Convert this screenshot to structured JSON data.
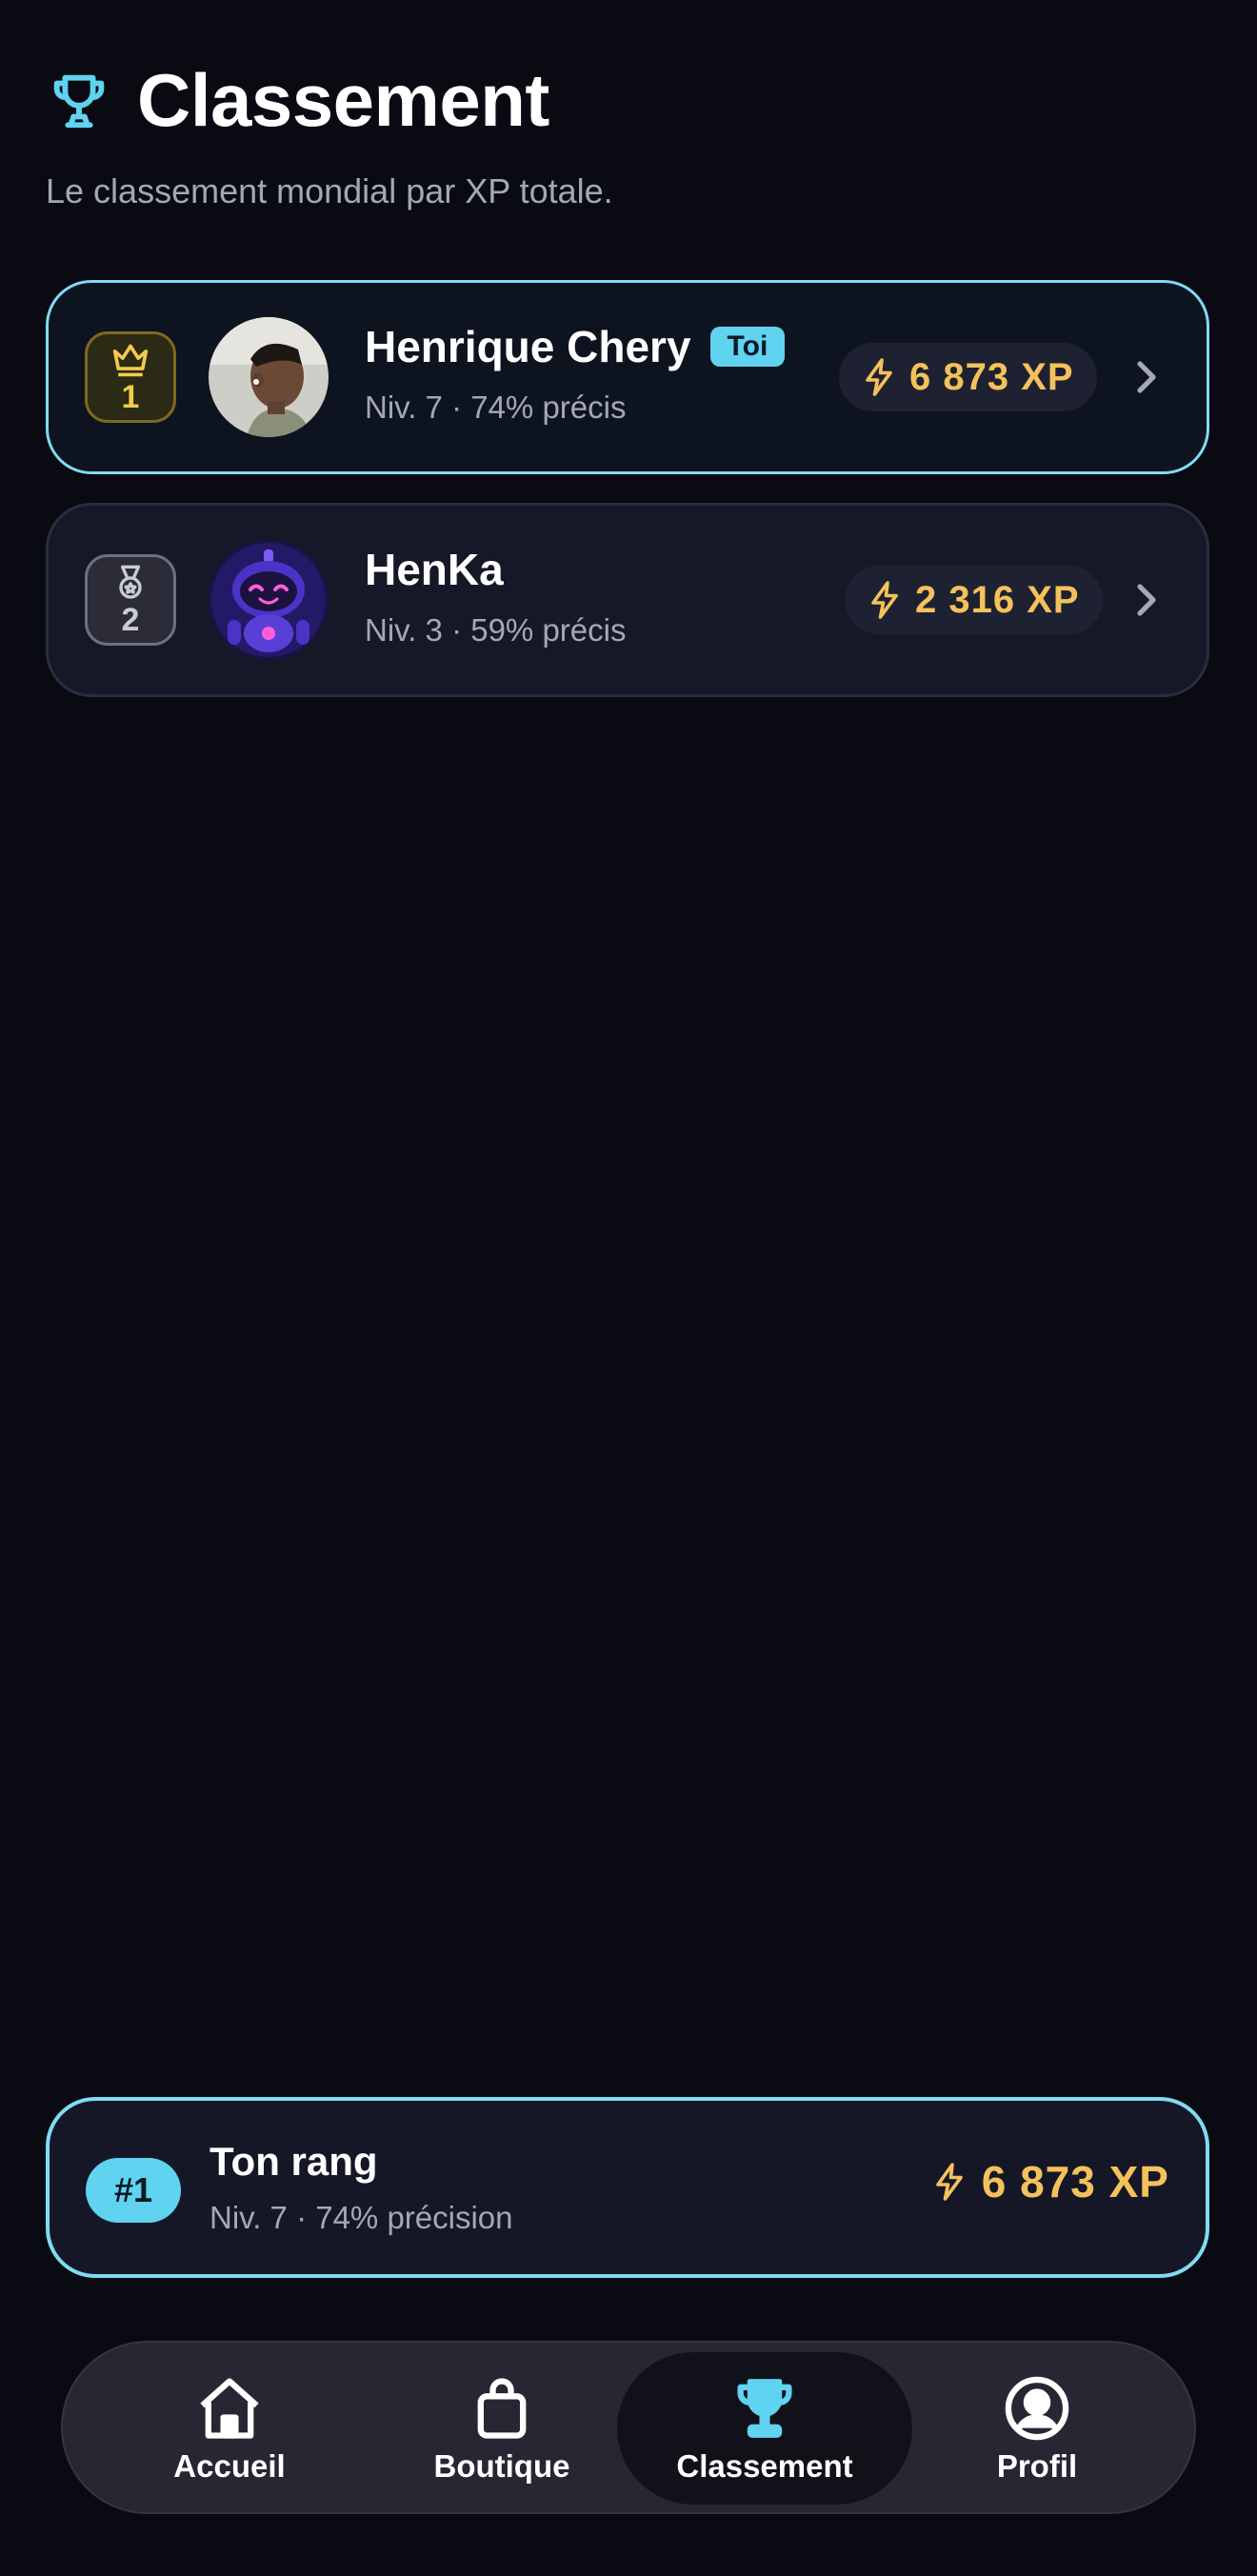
{
  "header": {
    "title": "Classement",
    "subtitle": "Le classement mondial par XP totale."
  },
  "leaderboard": [
    {
      "rank": "1",
      "name": "Henrique Chery",
      "tag": "Toi",
      "stats": "Niv. 7 · 74% précis",
      "xp": "6 873 XP"
    },
    {
      "rank": "2",
      "name": "HenKa",
      "stats": "Niv. 3 · 59% précis",
      "xp": "2 316 XP"
    }
  ],
  "my_rank": {
    "position": "#1",
    "label": "Ton rang",
    "stats": "Niv. 7 · 74% précision",
    "xp": "6 873 XP"
  },
  "nav": {
    "items": [
      {
        "label": "Accueil",
        "icon": "home-icon"
      },
      {
        "label": "Boutique",
        "icon": "bag-icon"
      },
      {
        "label": "Classement",
        "icon": "trophy-icon",
        "active": true
      },
      {
        "label": "Profil",
        "icon": "profile-icon"
      }
    ]
  },
  "colors": {
    "background": "#090a12",
    "accent": "#5fd3f0",
    "xp": "#f4c25a",
    "gold": "#f3cb4d"
  }
}
